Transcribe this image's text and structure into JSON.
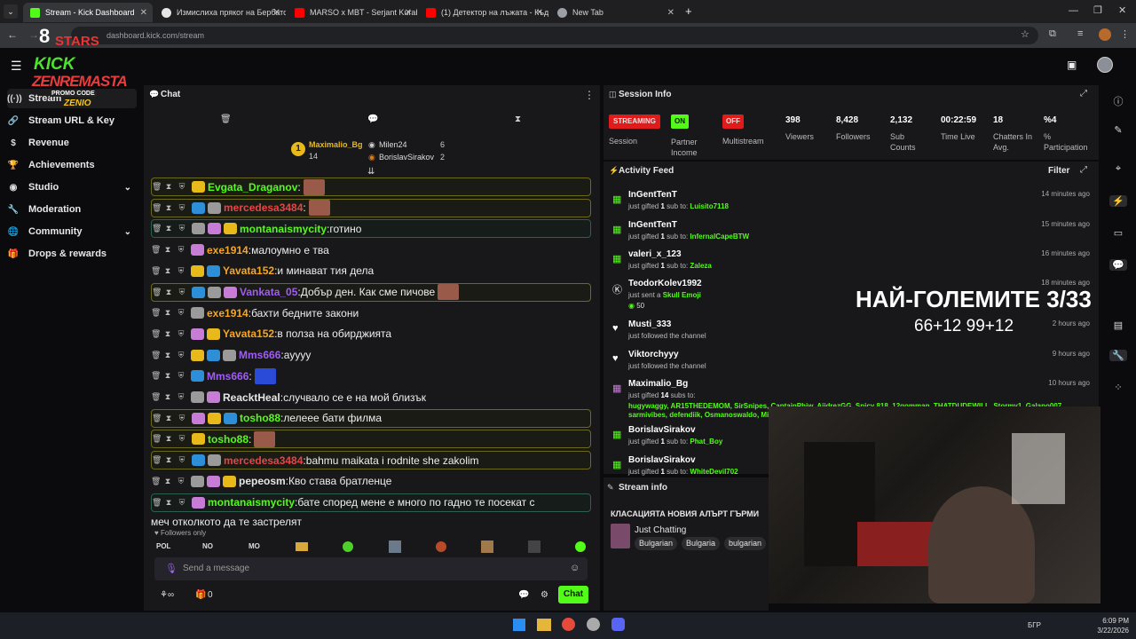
{
  "browser": {
    "tabs": [
      {
        "label": "Stream - Kick Dashboard",
        "color": "#53fc18"
      },
      {
        "label": "Измислиха пряког на Бербатов",
        "color": "#e5e5e5"
      },
      {
        "label": "MARSO x MBT - Serjant Kuraba",
        "color": "#ff0000"
      },
      {
        "label": "(1) Детектор на лъжата - Къде",
        "color": "#ff0000"
      },
      {
        "label": "New Tab",
        "color": "#9aa0a6"
      }
    ],
    "url": "dashboard.kick.com/stream"
  },
  "sidebar": {
    "items": [
      {
        "label": "Stream",
        "icon": "broadcast-icon"
      },
      {
        "label": "Stream URL & Key",
        "icon": "link-icon"
      },
      {
        "label": "Revenue",
        "icon": "dollar-icon"
      },
      {
        "label": "Achievements",
        "icon": "trophy-icon"
      },
      {
        "label": "Studio",
        "icon": "palette-icon"
      },
      {
        "label": "Moderation",
        "icon": "wrench-icon"
      },
      {
        "label": "Community",
        "icon": "globe-icon"
      },
      {
        "label": "Drops & rewards",
        "icon": "gift-icon"
      }
    ]
  },
  "overlay": {
    "stars": "STARS",
    "logo_top": "KICK",
    "logo_mid": "ZENREMASTA",
    "promo": "PROMO CODE",
    "promo_code": "ZENIO"
  },
  "chat": {
    "title": "Chat",
    "leaderboard": {
      "first": {
        "name": "Maximalio_Bg",
        "count": "14"
      },
      "second": {
        "name": "Milen24",
        "count": "6"
      },
      "third": {
        "name": "BorislavSirakov",
        "count": "2"
      }
    },
    "messages": [
      {
        "user": "Evgata_Draganov",
        "text": "",
        "color": "#53fc18",
        "hl": "hl"
      },
      {
        "user": "mercedesa3484",
        "text": "",
        "color": "#e64545",
        "hl": "hl"
      },
      {
        "user": "montanaismycity",
        "text": "готино",
        "color": "#53fc18",
        "hl": "hlg"
      },
      {
        "user": "exe1914",
        "text": "малоумно е тва",
        "color": "#f6a623",
        "hl": ""
      },
      {
        "user": "Yavata152",
        "text": "и минават тия дела",
        "color": "#f6a623",
        "hl": ""
      },
      {
        "user": "Vankata_05",
        "text": "Добър ден. Как сме пичове",
        "color": "#a05cf5",
        "hl": "hl"
      },
      {
        "user": "exe1914",
        "text": "бахти бедните закони",
        "color": "#f6a623",
        "hl": ""
      },
      {
        "user": "Yavata152",
        "text": "в полза на обирджията",
        "color": "#f6a623",
        "hl": ""
      },
      {
        "user": "Mms666",
        "text": "ayyyy",
        "color": "#a05cf5",
        "hl": ""
      },
      {
        "user": "Mms666",
        "text": "",
        "color": "#a05cf5",
        "hl": ""
      },
      {
        "user": "ReacktHeal",
        "text": "случвало се е на мой близък",
        "color": "#e6e6e6",
        "hl": ""
      },
      {
        "user": "tosho88",
        "text": "лелеее бати филма",
        "color": "#53fc18",
        "hl": "hl"
      },
      {
        "user": "tosho88",
        "text": "",
        "color": "#53fc18",
        "hl": "hl"
      },
      {
        "user": "mercedesa3484",
        "text": "bahmu maikata i rodnite she zakolim",
        "color": "#e64545",
        "hl": "hl"
      },
      {
        "user": "pepeosm",
        "text": "Кво става братленце",
        "color": "#e6e6e6",
        "hl": ""
      },
      {
        "user": "montanaismycity",
        "text": "бате според мене е много по гадно те посекат с",
        "color": "#53fc18",
        "hl": "hlg"
      }
    ],
    "last_line_cont": "меч отколкото да те застрелят",
    "followers_only": "Followers only",
    "emote_bar": [
      "POL",
      "NO",
      "MO"
    ],
    "input_placeholder": "Send a message",
    "footer_count": "0",
    "chat_button": "Chat"
  },
  "session": {
    "title": "Session Info",
    "streaming": "STREAMING",
    "streaming_label": "Session",
    "partner_badge": "ON",
    "partner_label": "Partner Income",
    "multistream_badge": "OFF",
    "multistream_label": "Multistream",
    "stats": [
      {
        "value": "398",
        "label": "Viewers"
      },
      {
        "value": "8,428",
        "label": "Followers"
      },
      {
        "value": "2,132",
        "label": "Sub Counts"
      },
      {
        "value": "00:22:59",
        "label": "Time Live"
      },
      {
        "value": "18",
        "label": "Chatters In Avg."
      },
      {
        "value": "%4",
        "label": "% Participation"
      }
    ]
  },
  "activity": {
    "title": "Activity Feed",
    "filter": "Filter",
    "items": [
      {
        "user": "InGentTenT",
        "pre": "just gifted ",
        "num": "1",
        "mid": " sub to: ",
        "target": "Luisito7118",
        "time": "14 minutes ago",
        "icon": "gift-icon"
      },
      {
        "user": "InGentTenT",
        "pre": "just gifted ",
        "num": "1",
        "mid": " sub to: ",
        "target": "InfernalCapeBTW",
        "time": "15 minutes ago",
        "icon": "gift-icon"
      },
      {
        "user": "valeri_x_123",
        "pre": "just gifted ",
        "num": "1",
        "mid": " sub to: ",
        "target": "Zaleza",
        "time": "16 minutes ago",
        "icon": "gift-icon"
      },
      {
        "user": "TeodorKolev1992",
        "pre": "just sent a ",
        "num": "",
        "mid": "",
        "target": "Skull Emoji",
        "time": "18 minutes ago",
        "icon": "kick-icon"
      },
      {
        "user": "Musti_333",
        "pre": "just followed the channel",
        "num": "",
        "mid": "",
        "target": "",
        "time": "2 hours ago",
        "icon": "heart-icon"
      },
      {
        "user": "Viktorchyyy",
        "pre": "just followed the channel",
        "num": "",
        "mid": "",
        "target": "",
        "time": "9 hours ago",
        "icon": "heart-icon"
      },
      {
        "user": "Maximalio_Bg",
        "pre": "just gifted ",
        "num": "14",
        "mid": " subs to:",
        "target": "",
        "time": "10 hours ago",
        "icon": "gift-icon"
      },
      {
        "user": "BorislavSirakov",
        "pre": "just gifted ",
        "num": "1",
        "mid": " sub to: ",
        "target": "Phat_Boy",
        "time": "",
        "icon": "gift-icon"
      },
      {
        "user": "BorislavSirakov",
        "pre": "just gifted ",
        "num": "1",
        "mid": " sub to: ",
        "target": "WhiteDevil702",
        "time": "",
        "icon": "gift-icon"
      }
    ],
    "gift_recipients": "hugywaggy, AR15THEDEMOM, SirSnipes, CaptainPhiw, AiidrezGG, Spicy 818, 12gomman, THATDUDEWILL, Stormy1, Galano007, sarmivibes, defendiik, Osmanoswaldo, Migueldomi",
    "teodor_amount": "50"
  },
  "streaminfo": {
    "title": "Stream info",
    "stream_title": "КЛАСАЦИЯТА НОВИЯ АЛЪРТ ГЪРМИ",
    "category": "Just Chatting",
    "tags": [
      "Bulgarian",
      "Bulgaria",
      "bulgarian"
    ]
  },
  "stream_overlay": {
    "headline": "НАЙ-ГОЛЕМИТЕ 3/33",
    "scores": "66+12 99+12"
  },
  "taskbar": {
    "time": "6:09 PM",
    "date": "3/22/2026",
    "lang": "БГР"
  }
}
